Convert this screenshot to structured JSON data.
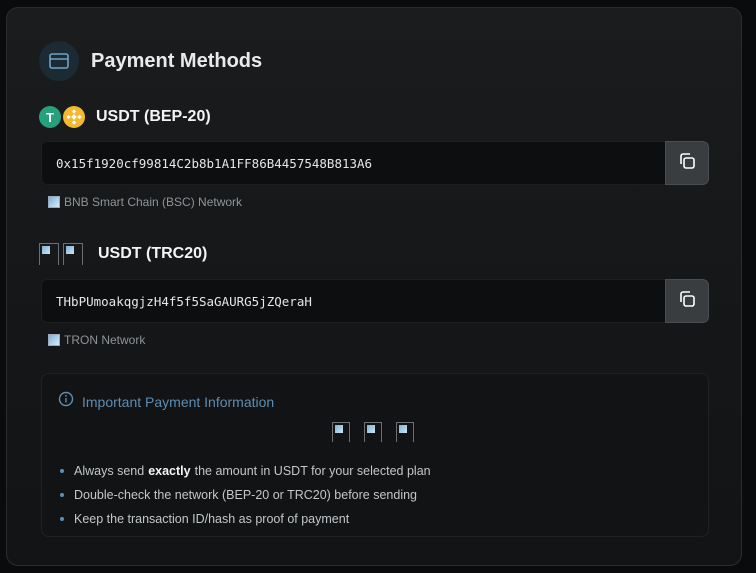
{
  "header": {
    "title": "Payment Methods",
    "icon": "credit-card-icon"
  },
  "methods": [
    {
      "label": "USDT (BEP-20)",
      "address": "0x15f1920cf99814C2b8b1A1FF86B4457548B813A6",
      "network": "BNB Smart Chain (BSC) Network"
    },
    {
      "label": "USDT (TRC20)",
      "address": "THbPUmoakqgjzH4f5f5SaGAURG5jZQeraH",
      "network": "TRON Network"
    }
  ],
  "info": {
    "title": "Important Payment Information",
    "bullets": {
      "b1_pre": "Always send",
      "b1_bold": "exactly",
      "b1_post": "the amount in USDT for your selected plan",
      "b2": "Double-check the network (BEP-20 or TRC20) before sending",
      "b3": "Keep the transaction ID/hash as proof of payment"
    }
  },
  "colors": {
    "accent": "#5d8db3",
    "tether": "#26a17b",
    "bnb": "#f3ba2f"
  }
}
